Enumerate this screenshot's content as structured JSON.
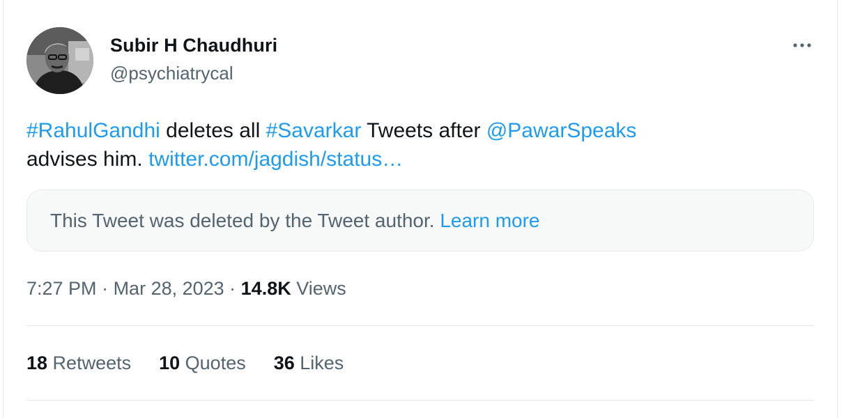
{
  "author": {
    "name": "Subir H Chaudhuri",
    "handle": "@psychiatrycal"
  },
  "tweet": {
    "hashtag1": "#RahulGandhi",
    "text1": " deletes all ",
    "hashtag2": "#Savarkar",
    "text2": " Tweets after ",
    "mention": "@PawarSpeaks",
    "text3": "advises him. ",
    "link": "twitter.com/jagdish/status…"
  },
  "quoted": {
    "message": "This Tweet was deleted by the Tweet author. ",
    "learn_more": "Learn more"
  },
  "meta": {
    "time": "7:27 PM",
    "sep1": " · ",
    "date": "Mar 28, 2023",
    "sep2": " · ",
    "views_count": "14.8K",
    "views_label": " Views"
  },
  "stats": {
    "retweets_count": "18",
    "retweets_label": " Retweets",
    "quotes_count": "10",
    "quotes_label": " Quotes",
    "likes_count": "36",
    "likes_label": " Likes"
  },
  "icons": {
    "more": "more-horizontal-icon"
  },
  "colors": {
    "link": "#1d9bf0",
    "secondary_text": "#536471",
    "primary_text": "#0f1419",
    "border": "#e6e9eb",
    "quote_bg": "#f7f9f9"
  }
}
